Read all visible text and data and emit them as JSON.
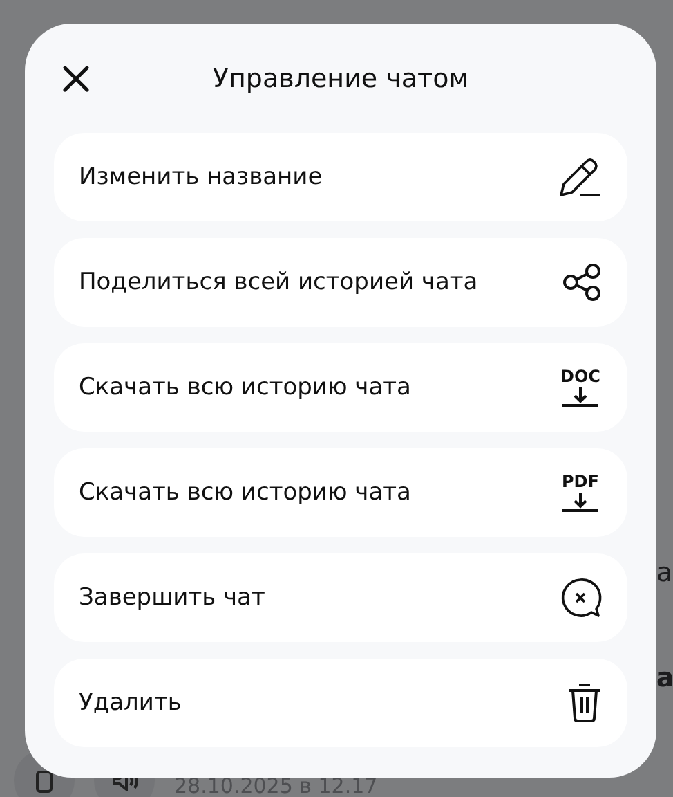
{
  "background": {
    "right_fragments": [
      {
        "text": "а",
        "bold": false
      },
      {
        "text": "а",
        "bold": true
      }
    ],
    "timestamp": "28.10.2025 в 12.17"
  },
  "dialog": {
    "title": "Управление чатом",
    "items": [
      {
        "label": "Изменить название",
        "kind": "edit"
      },
      {
        "label": "Поделиться всей историей чата",
        "kind": "share"
      },
      {
        "label": "Скачать всю историю чата",
        "kind": "file",
        "badge": "DOC"
      },
      {
        "label": "Скачать всю историю чата",
        "kind": "file",
        "badge": "PDF"
      },
      {
        "label": "Завершить чат",
        "kind": "end"
      },
      {
        "label": "Удалить",
        "kind": "delete"
      }
    ]
  }
}
